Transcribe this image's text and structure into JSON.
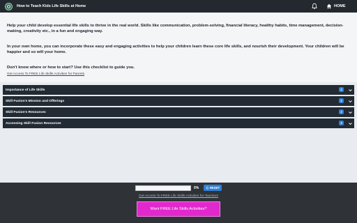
{
  "header": {
    "title": "How to Teach Kids Life Skills at Home",
    "home_label": "HOME",
    "icons": [
      "logo-icon",
      "bell-icon",
      "home-icon"
    ]
  },
  "intro": {
    "p1": "Help your child develop essential life skills to thrive in the real world. Skills like communication, problem-solving, financial literacy, healthy habits, time management, decision-making, creativity etc., in a fun and engaging way.",
    "p2": "In your own home, you can incorporate these easy and engaging activities to help your children learn these core life skills, and nourish their development. Your children will be happier and so will your home.",
    "p3": "Don't know where or how to start? Use this checklist to guide you.",
    "link": "Get Access To FREE Life Skills Activities for Parents"
  },
  "accordion": [
    {
      "title": "Importance of Life Skills",
      "count": "2"
    },
    {
      "title": "Skill Fusion's Mission and Offerings",
      "count": "2"
    },
    {
      "title": "Skill Fusion's Resources",
      "count": "2"
    },
    {
      "title": "Accessing Skill Fusion Resources",
      "count": "3"
    }
  ],
  "footer": {
    "progress_percent": 0,
    "progress_label": "0%",
    "reset_label": "RESET",
    "link": "Get Access To FREE Life Skills Activities for Teachers",
    "cta_label": "Want FREE Life Skills Activities?"
  },
  "colors": {
    "header_bg": "#24292f",
    "accordion_bg": "#222a33",
    "badge": "#2f7fd7",
    "cta": "#e128cd",
    "footer_bg": "#2f3338"
  }
}
